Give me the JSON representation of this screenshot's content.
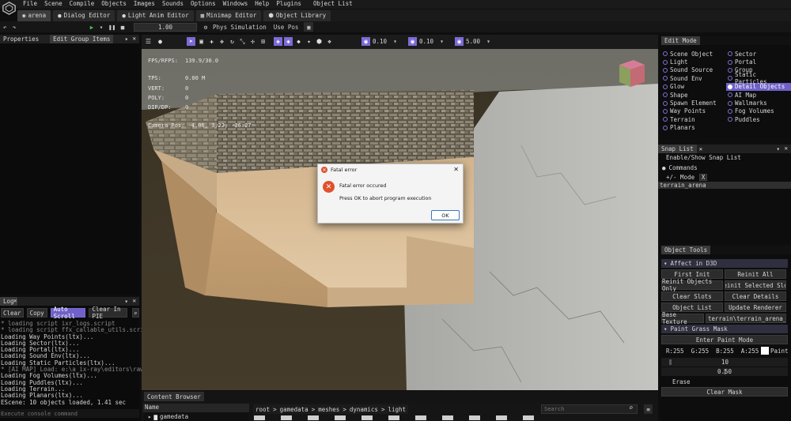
{
  "menu": {
    "items": [
      "File",
      "Scene",
      "Compile",
      "Objects",
      "Images",
      "Sounds",
      "Options",
      "Windows",
      "Help",
      "Plugins"
    ],
    "object_list": "Object List"
  },
  "tabs": [
    {
      "label": "arena",
      "icon": "globe-icon"
    },
    {
      "label": "Dialog Editor",
      "icon": "chat-icon"
    },
    {
      "label": "Light Anim Editor",
      "icon": "bulb-icon"
    },
    {
      "label": "Minimap Editor",
      "icon": "map-icon"
    },
    {
      "label": "Object Library",
      "icon": "cube-icon"
    }
  ],
  "toolbar": {
    "play": "▶",
    "value": "1.00",
    "phys_simulation": "Phys Simulation",
    "use_pos": "Use Pos"
  },
  "left_panel": {
    "tab_properties": "Properties",
    "tab_edit_group": "Edit Group Items"
  },
  "viewport": {
    "snap1": "0.10",
    "snap2": "0.10",
    "snap3": "5.00",
    "stats": {
      "fps_label": "FPS/RFPS:",
      "fps_value": "139.9/30.0",
      "tps_label": "TPS:",
      "tps_value": "0.00 M",
      "vert_label": "VERT:",
      "vert_value": "0",
      "poly_label": "POLY:",
      "poly_value": "0",
      "dip_label": "DIP/DP:",
      "dip_value": "0",
      "camera": "Camera Pos: -4.06, 3.22, -26.27"
    }
  },
  "dialog": {
    "title": "Fatal error",
    "heading": "Fatal error occured",
    "message": "Press OK to abort program execution",
    "ok": "OK"
  },
  "edit_mode": {
    "title": "Edit Mode",
    "left": [
      "Scene Object",
      "Light",
      "Sound Source",
      "Sound Env",
      "Glow",
      "Shape",
      "Spawn Element",
      "Way Points",
      "Terrain",
      "Planars"
    ],
    "right": [
      "Sector",
      "Portal",
      "Group",
      "Static Particles",
      "Detail Objects",
      "AI Map",
      "Wallmarks",
      "Fog Volumes",
      "Puddles"
    ],
    "selected": "Detail Objects"
  },
  "snap_list": {
    "title": "Snap List",
    "enable": "Enable/Show Snap List",
    "commands": "Commands",
    "mode": "+/- Mode",
    "mode_x": "X",
    "item": "terrain_arena"
  },
  "object_tools": {
    "title": "Object Tools",
    "affect": "Affect in D3D",
    "first_init": "First Init",
    "reinit_all": "Reinit All",
    "reinit_only": "Reinit Objects Only",
    "reinit_selected": "Reinit Selected Slot",
    "clear_slots": "Clear Slots",
    "clear_details": "Clear Details",
    "object_list": "Object List",
    "update_renderer": "Update Renderer",
    "base_texture": "Base Texture",
    "texture_path": "terrain\\terrain_arena_det",
    "paint_grass": "Paint Grass Mask",
    "enter_paint": "Enter Paint Mode",
    "r": "R:255",
    "g": "G:255",
    "b": "B:255",
    "a": "A:255",
    "paint": "Paint",
    "val10": "10",
    "val050": "0.50",
    "erase": "Erase",
    "clear_mask": "Clear Mask"
  },
  "log": {
    "title": "Log",
    "buttons": [
      "Clear",
      "Copy",
      "Auto Scroll",
      "Clear In PIE"
    ],
    "lines": [
      "* loading script ixr_logs.script",
      "* loading script ffx_callable_utils.script",
      "Loading Way Points(ltx)...",
      "Loading Sector(ltx)...",
      "Loading Portal(ltx)...",
      "Loading Sound Env(ltx)...",
      "Loading Static Particles(ltx)...",
      "* [AI MAP] Load: e:\\a_ix-ray\\editors\\rawdata",
      "Loading Fog Volumes(ltx)...",
      "Loading Puddles(ltx)...",
      "Loading Terrain...",
      "Loading Planars(ltx)...",
      "EScene: 10 objects loaded, 1.41 sec"
    ],
    "input_placeholder": "Execute console command"
  },
  "content_browser": {
    "title": "Content Browser",
    "name_col": "Name",
    "tree_item": "gamedata",
    "path": [
      "root",
      ">",
      "gamedata",
      ">",
      "meshes",
      ">",
      "dynamics",
      ">",
      "light"
    ],
    "search_placeholder": "Search"
  },
  "colors": {
    "accent": "#7b6bd6",
    "error": "#e0512e",
    "bg": "#0e0e0e"
  }
}
